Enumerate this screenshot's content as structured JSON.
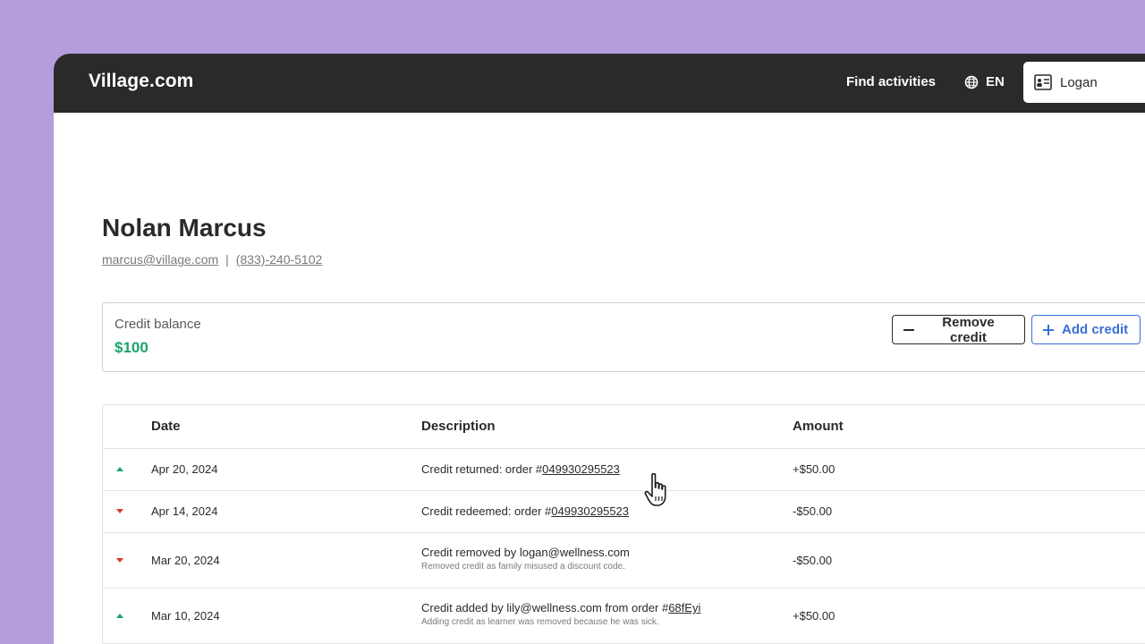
{
  "header": {
    "logo": "Village.com",
    "nav_find": "Find activities",
    "language": "EN",
    "user_name": "Logan"
  },
  "profile": {
    "name": "Nolan Marcus",
    "email": "marcus@village.com",
    "separator": "|",
    "phone": "(833)-240-5102"
  },
  "credit": {
    "label": "Credit balance",
    "amount": "$100",
    "remove_label": "Remove credit",
    "add_label": "Add credit",
    "amount_color": "#1aa468",
    "add_color": "#3b6fd6"
  },
  "table": {
    "columns": [
      "Date",
      "Description",
      "Amount"
    ],
    "rows": [
      {
        "direction": "up",
        "date": "Apr 20, 2024",
        "desc_prefix": "Credit returned: order #",
        "desc_link": "049930295523",
        "sub": "",
        "amount": "+$50.00"
      },
      {
        "direction": "down",
        "date": "Apr 14, 2024",
        "desc_prefix": "Credit redeemed: order #",
        "desc_link": "049930295523",
        "sub": "",
        "amount": "-$50.00"
      },
      {
        "direction": "down",
        "date": "Mar 20, 2024",
        "desc_prefix": "Credit removed by logan@wellness.com",
        "desc_link": "",
        "sub": "Removed credit as family misused a discount code.",
        "amount": "-$50.00"
      },
      {
        "direction": "up",
        "date": "Mar 10, 2024",
        "desc_prefix": "Credit added by lily@wellness.com from order #",
        "desc_link": "68fEyi",
        "sub": "Adding credit as learner was removed because he was sick.",
        "amount": "+$50.00"
      }
    ]
  },
  "icons": {
    "globe": "globe-icon",
    "user_card": "id-card-icon",
    "minus": "minus-icon",
    "plus": "plus-icon",
    "cursor": "hand-pointer-cursor"
  }
}
